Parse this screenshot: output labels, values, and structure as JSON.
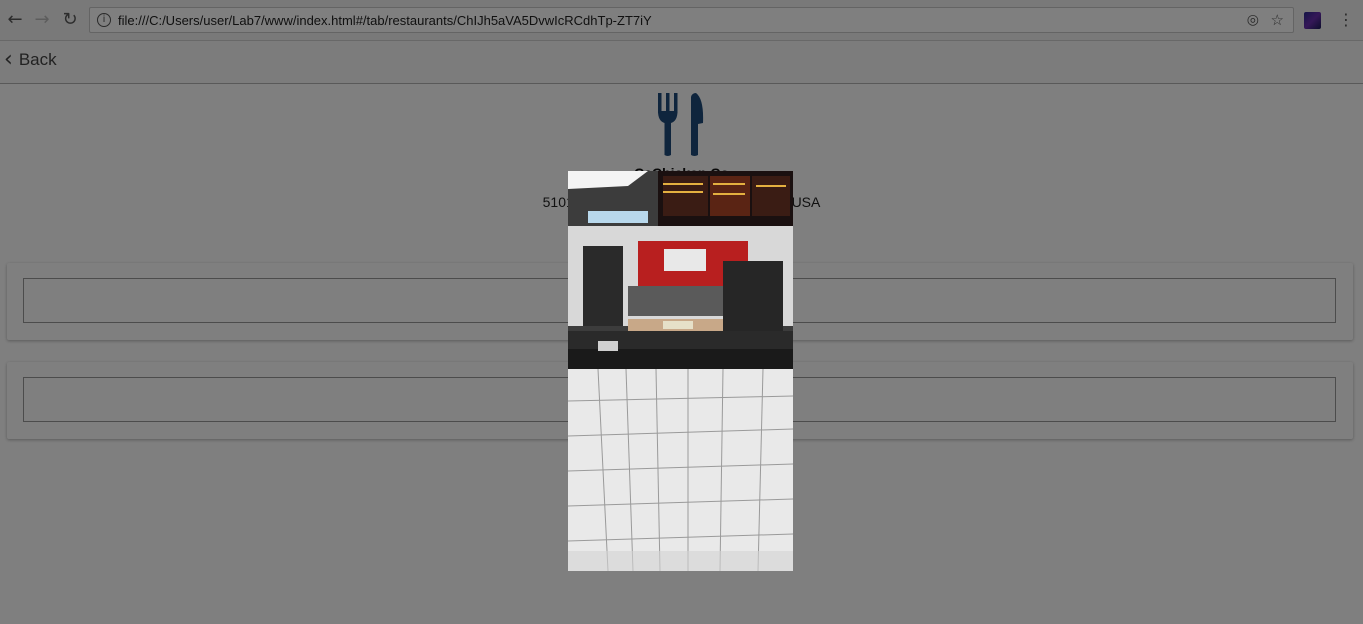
{
  "browser": {
    "back_icon": "arrow-left-icon",
    "forward_icon": "arrow-right-icon",
    "reload_icon": "reload-icon",
    "url": "file:///C:/Users/user/Lab7/www/index.html#/tab/restaurants/ChIJh5aVA5DvwIcRCdhTp-ZT7iY",
    "info_icon": "info-icon",
    "location_icon": "location-icon",
    "bookmark_icon": "star-icon",
    "menu_icon": "kebab-menu-icon"
  },
  "header": {
    "back_label": "Back"
  },
  "restaurant": {
    "icon": "fork-knife-icon",
    "name": "CaChicken Co",
    "address": "5101",
    "address_end": "USA"
  },
  "photo_modal": {
    "description_icon": "restaurant-photo",
    "overlay_color": "#000000"
  },
  "colors": {
    "icon_color": "#1f4b7a",
    "header_bg": "#f8f8f8"
  }
}
